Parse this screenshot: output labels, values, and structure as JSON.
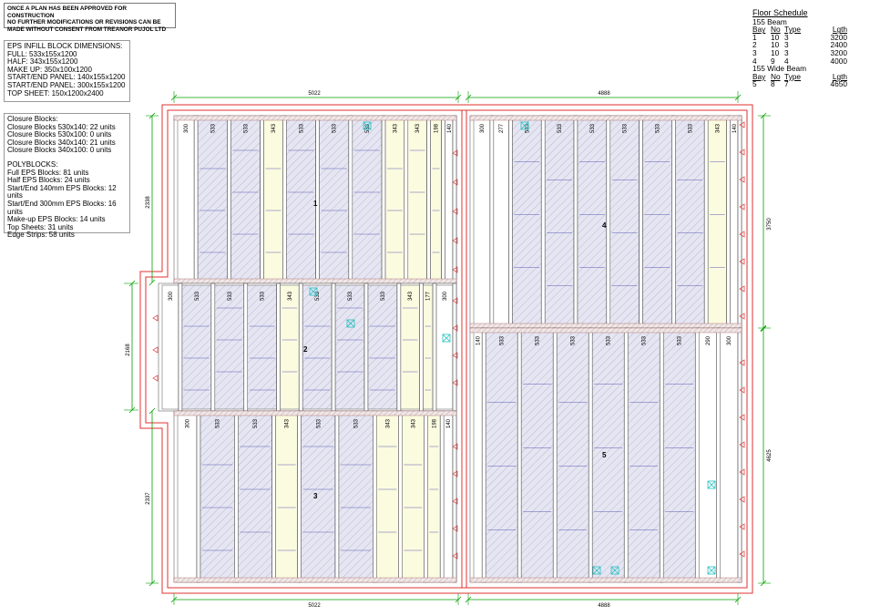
{
  "approval_note": {
    "lines": [
      "ONCE A PLAN HAS BEEN APPROVED FOR CONSTRUCTION",
      "NO FURTHER MODIFICATIONS OR REVISIONS CAN BE",
      "MADE WITHOUT CONSENT FROM TREANOR PUJOL LTD"
    ]
  },
  "eps_dimensions": {
    "title": "EPS INFILL BLOCK DIMENSIONS:",
    "items": [
      "FULL: 533x155x1200",
      "HALF: 343x155x1200",
      "MAKE UP: 350x100x1200",
      "START/END PANEL: 140x155x1200",
      "START/END PANEL: 300x155x1200",
      "TOP SHEET: 150x1200x2400"
    ]
  },
  "closure_blocks": {
    "title": "Closure Blocks:",
    "items": [
      "Closure Blocks 530x140: 22 units",
      "Closure Blocks 530x100: 0 units",
      "Closure Blocks 340x140: 21 units",
      "Closure Blocks 340x100: 0 units"
    ]
  },
  "polyblocks": {
    "title": "POLYBLOCKS:",
    "items": [
      "Full EPS Blocks: 81 units",
      "Half EPS Blocks: 24 units",
      "Start/End 140mm EPS Blocks: 12 units",
      "Start/End 300mm EPS Blocks: 16 units",
      "Make-up EPS Blocks: 14 units",
      "Top Sheets: 31 units",
      "Edge Strips: 58 units"
    ]
  },
  "floor_schedule": {
    "title": "Floor Schedule",
    "group1": {
      "name": "155 Beam",
      "headers": [
        "Bay",
        "No",
        "Type",
        "Lgth"
      ],
      "rows": [
        [
          "1",
          "10",
          "3",
          "3200"
        ],
        [
          "2",
          "10",
          "3",
          "2400"
        ],
        [
          "3",
          "10",
          "3",
          "3200"
        ],
        [
          "4",
          "9",
          "4",
          "4000"
        ]
      ]
    },
    "group2": {
      "name": "155 Wide Beam",
      "headers": [
        "Bay",
        "No",
        "Type",
        "Lgth"
      ],
      "rows": [
        [
          "5",
          "8",
          "7",
          "4650"
        ]
      ]
    }
  },
  "dimensions": {
    "top_left": "5022",
    "top_right": "4888",
    "bottom_left": "5022",
    "bottom_right": "4888",
    "left_upper": "2338",
    "left_middle": "2168",
    "left_lower": "2337",
    "right_upper": "3750",
    "right_lower": "4625"
  },
  "bays": {
    "bay1": {
      "label": "1",
      "blocks": [
        "300",
        "533",
        "533",
        "343",
        "533",
        "533",
        "533",
        "343",
        "343",
        "198",
        "140"
      ]
    },
    "bay2": {
      "label": "2",
      "blocks": [
        "300",
        "533",
        "533",
        "533",
        "343",
        "533",
        "533",
        "533",
        "343",
        "177",
        "300"
      ]
    },
    "bay3": {
      "label": "3",
      "blocks": [
        "300",
        "533",
        "533",
        "343",
        "533",
        "533",
        "343",
        "343",
        "198",
        "140"
      ]
    },
    "bay4": {
      "label": "4",
      "blocks": [
        "300",
        "277",
        "533",
        "533",
        "533",
        "533",
        "533",
        "533",
        "343",
        "140"
      ]
    },
    "bay5": {
      "label": "5",
      "blocks": [
        "140",
        "533",
        "533",
        "533",
        "533",
        "533",
        "533",
        "290",
        "300"
      ]
    }
  },
  "colors": {
    "wall": "#e03030",
    "dimension": "#00a000",
    "hatch": "#9090b0",
    "block_fill": "#e4e4f2",
    "make_up_fill": "#fbfbe0",
    "closure": "#20c0c0"
  }
}
